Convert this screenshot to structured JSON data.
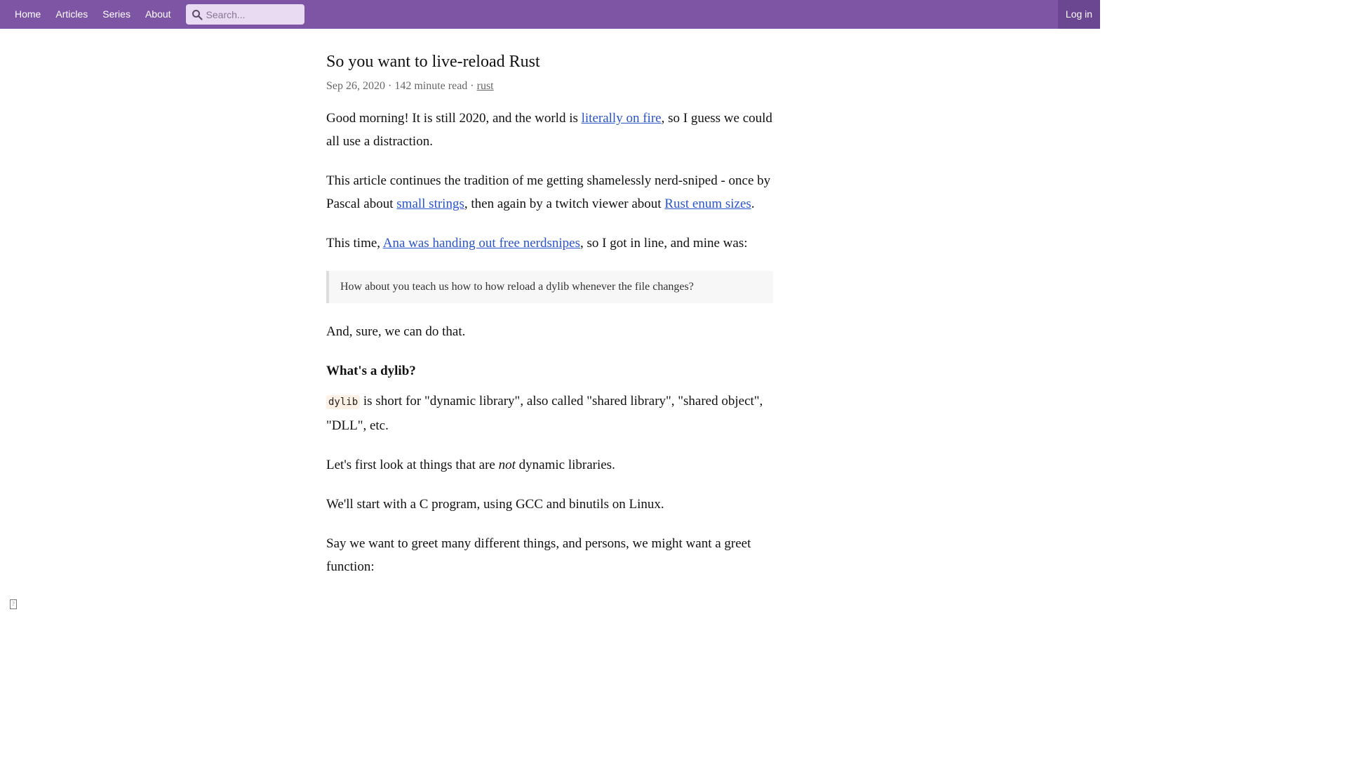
{
  "nav": {
    "links": [
      "Home",
      "Articles",
      "Series",
      "About"
    ],
    "search_placeholder": "Search...",
    "login_label": "Log in",
    "colors": {
      "bar": "#7e55a5",
      "login_bg": "#6a4790"
    }
  },
  "article": {
    "title": "So you want to live-reload Rust",
    "meta_text": "Sep 26, 2020 · 142 minute read · ",
    "tag": "rust",
    "p1": {
      "before": "Good morning! It is still 2020, and the world is ",
      "link": "literally on fire",
      "after": ", so I guess we could all use a distraction."
    },
    "p2": {
      "before": "This article continues the tradition of me getting shamelessly nerd-sniped - once by Pascal about ",
      "link1": "small strings",
      "middle": ", then again by a twitch viewer about ",
      "link2": "Rust enum sizes",
      "after": "."
    },
    "p3": {
      "before": "This time, ",
      "link": "Ana was handing out free nerdsnipes",
      "after": ", so I got in line, and mine was:"
    },
    "quote": "How about you teach us how to how reload a dylib whenever the file changes?",
    "p4": "And, sure, we can do that.",
    "heading": "What's a dylib?",
    "p5": {
      "code": "dylib",
      "after": " is short for \"dynamic library\", also called \"shared library\", \"shared object\", \"DLL\", etc."
    },
    "p6": {
      "before": "Let's first look at things that are ",
      "em": "not",
      "after": " dynamic libraries."
    },
    "p7": "We'll start with a C program, using GCC and binutils on Linux.",
    "p8": "Say we want to greet many different things, and persons, we might want a greet function:"
  },
  "link_color": "#2a54c8"
}
